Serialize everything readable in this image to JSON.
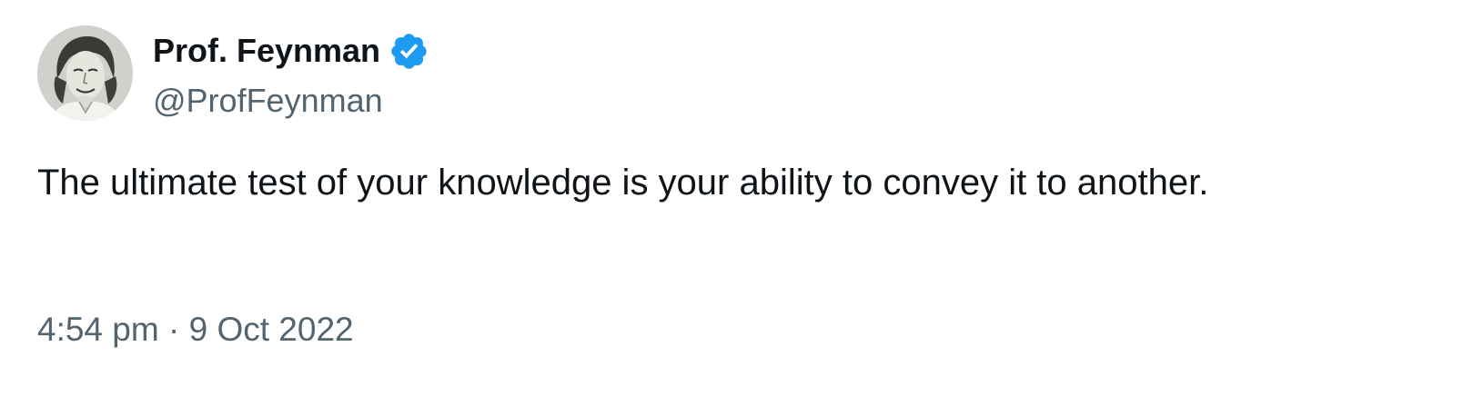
{
  "author": {
    "display_name": "Prof. Feynman",
    "handle": "@ProfFeynman",
    "verified": true,
    "verified_badge_color": "#1d9bf0"
  },
  "tweet": {
    "text": "The ultimate test of your knowledge is your ability to convey it to another.",
    "time": "4:54 pm",
    "separator": "·",
    "date": "9 Oct 2022"
  },
  "colors": {
    "primary_text": "#0f1419",
    "secondary_text": "#536471",
    "background": "#ffffff"
  }
}
